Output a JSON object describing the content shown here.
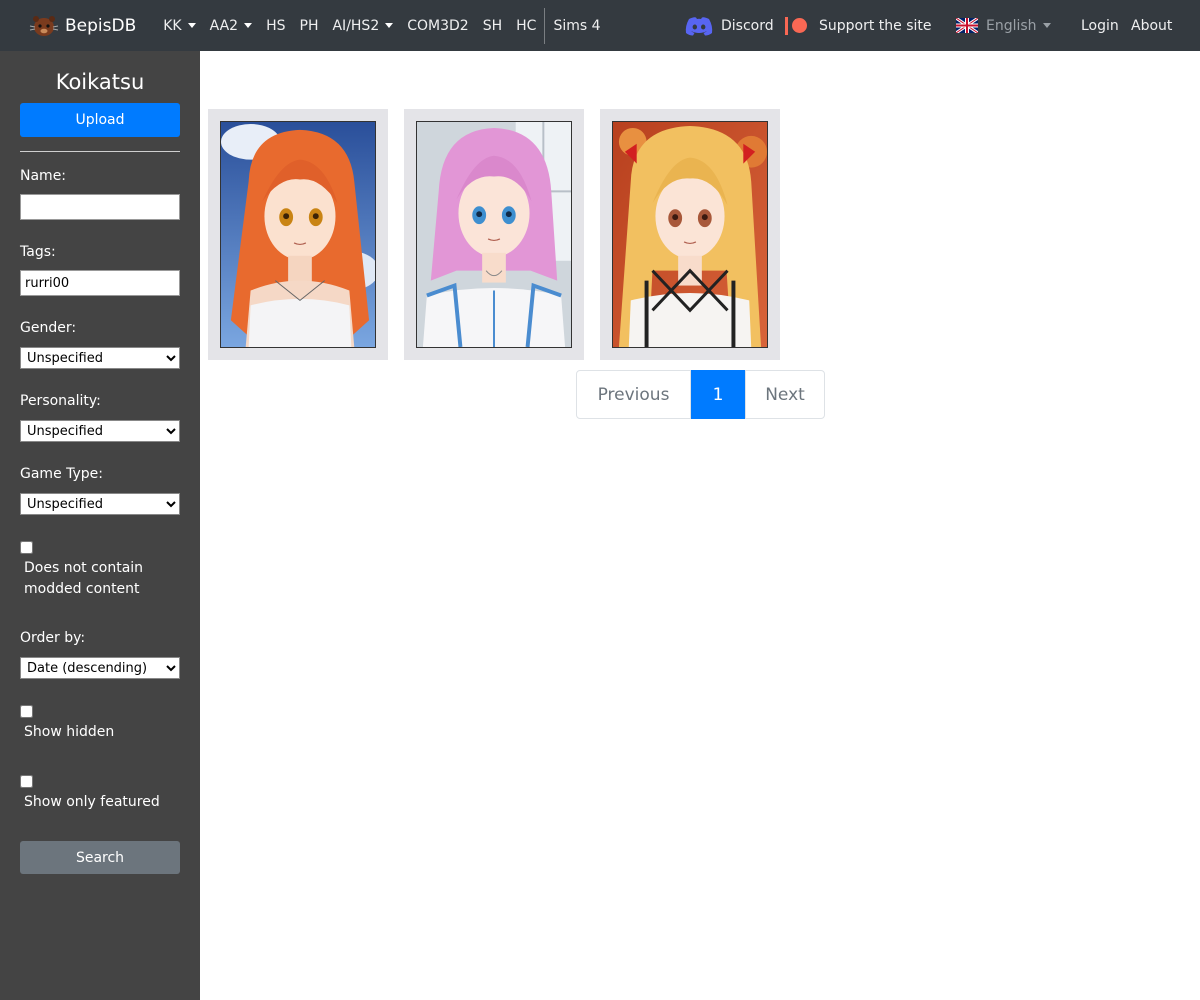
{
  "navbar": {
    "brand": "BepisDB",
    "items": [
      {
        "label": "KK",
        "dropdown": true
      },
      {
        "label": "AA2",
        "dropdown": true
      },
      {
        "label": "HS",
        "dropdown": false
      },
      {
        "label": "PH",
        "dropdown": false
      },
      {
        "label": "AI/HS2",
        "dropdown": true
      },
      {
        "label": "COM3D2",
        "dropdown": false
      },
      {
        "label": "SH",
        "dropdown": false
      },
      {
        "label": "HC",
        "dropdown": false
      },
      {
        "label": "Sims 4",
        "dropdown": false
      }
    ],
    "discord": "Discord",
    "support": "Support the site",
    "language": "English",
    "login": "Login",
    "about": "About"
  },
  "sidebar": {
    "title": "Koikatsu",
    "upload_label": "Upload",
    "name_label": "Name:",
    "name_value": "",
    "tags_label": "Tags:",
    "tags_value": "rurri00",
    "gender_label": "Gender:",
    "gender_value": "Unspecified",
    "personality_label": "Personality:",
    "personality_value": "Unspecified",
    "game_type_label": "Game Type:",
    "game_type_value": "Unspecified",
    "no_modded_label": "Does not contain modded content",
    "order_label": "Order by:",
    "order_value": "Date (descending)",
    "show_hidden_label": "Show hidden",
    "show_featured_label": "Show only featured",
    "search_label": "Search"
  },
  "pagination": {
    "previous": "Previous",
    "current": "1",
    "next": "Next"
  },
  "colors": {
    "navbar_bg": "#343a40",
    "sidebar_bg": "#444444",
    "primary": "#007bff",
    "secondary": "#6c757d"
  }
}
